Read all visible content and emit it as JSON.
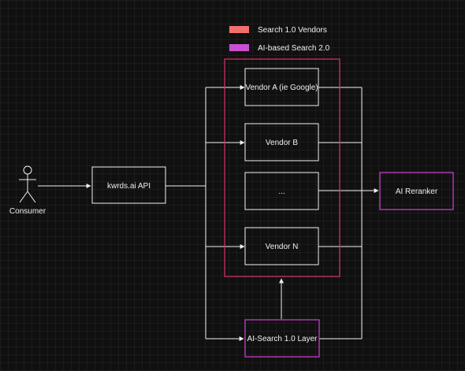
{
  "legend": {
    "items": [
      {
        "label": "Search 1.0 Vendors",
        "color": "#f26f6f"
      },
      {
        "label": "AI-based Search 2.0",
        "color": "#c94fd1"
      }
    ]
  },
  "actor": {
    "label": "Consumer",
    "icon": "stick-figure-icon"
  },
  "nodes": {
    "api": "kwrds.ai API",
    "vendor_a": "Vendor A (ie Google)",
    "vendor_b": "Vendor B",
    "vendor_ellipsis": "...",
    "vendor_n": "Vendor N",
    "reranker": "AI Reranker",
    "ai_layer": "AI-Search 1.0 Layer"
  },
  "colors": {
    "background": "#101010",
    "line": "#f0f0f0",
    "vendor_group_border": "#d9336f",
    "ai_border": "#d63fd6"
  }
}
